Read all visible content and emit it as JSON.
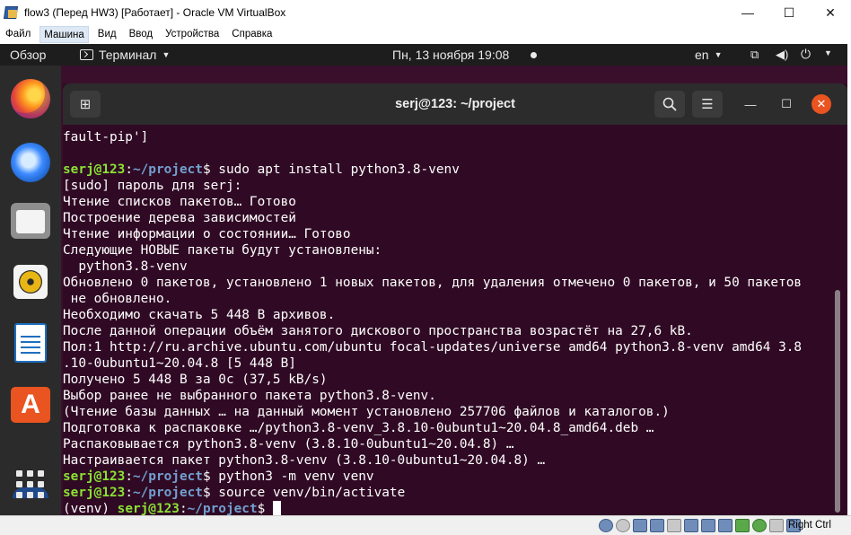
{
  "host_window": {
    "title": "flow3 (Перед HW3) [Работает] - Oracle VM VirtualBox",
    "controls": {
      "minimize": "—",
      "maximize": "☐",
      "close": "✕"
    }
  },
  "host_menu": [
    {
      "label": "Файл"
    },
    {
      "label": "Машина",
      "active": true
    },
    {
      "label": "Вид"
    },
    {
      "label": "Ввод"
    },
    {
      "label": "Устройства"
    },
    {
      "label": "Справка"
    }
  ],
  "topbar": {
    "overview": "Обзор",
    "app_name": "Терминал",
    "clock": "Пн, 13 ноября  19:08",
    "keyboard_layout": "en"
  },
  "dock": {
    "items": [
      "firefox-icon",
      "thunderbird-icon",
      "files-icon",
      "rhythmbox-icon",
      "libreoffice-writer-icon",
      "ubuntu-software-icon",
      "show-applications-icon"
    ]
  },
  "terminal": {
    "title": "serj@123: ~/project",
    "lines": [
      {
        "text": "fault-pip']"
      },
      {
        "text": ""
      },
      {
        "prompt_user": "serj@123",
        "prompt_path": "~/project",
        "command": "sudo apt install python3.8-venv"
      },
      {
        "text": "[sudo] пароль для serj:"
      },
      {
        "text": "Чтение списков пакетов… Готово"
      },
      {
        "text": "Построение дерева зависимостей"
      },
      {
        "text": "Чтение информации о состоянии… Готово"
      },
      {
        "text": "Следующие НОВЫЕ пакеты будут установлены:"
      },
      {
        "text": "  python3.8-venv"
      },
      {
        "text": "Обновлено 0 пакетов, установлено 1 новых пакетов, для удаления отмечено 0 пакетов, и 50 пакетов"
      },
      {
        "text": " не обновлено."
      },
      {
        "text": "Необходимо скачать 5 448 B архивов."
      },
      {
        "text": "После данной операции объём занятого дискового пространства возрастёт на 27,6 kB."
      },
      {
        "text": "Пол:1 http://ru.archive.ubuntu.com/ubuntu focal-updates/universe amd64 python3.8-venv amd64 3.8"
      },
      {
        "text": ".10-0ubuntu1~20.04.8 [5 448 B]"
      },
      {
        "text": "Получено 5 448 B за 0c (37,5 kB/s)"
      },
      {
        "text": "Выбор ранее не выбранного пакета python3.8-venv."
      },
      {
        "text": "(Чтение базы данных … на данный момент установлено 257706 файлов и каталогов.)"
      },
      {
        "text": "Подготовка к распаковке …/python3.8-venv_3.8.10-0ubuntu1~20.04.8_amd64.deb …"
      },
      {
        "text": "Распаковывается python3.8-venv (3.8.10-0ubuntu1~20.04.8) …"
      },
      {
        "text": "Настраивается пакет python3.8-venv (3.8.10-0ubuntu1~20.04.8) …"
      },
      {
        "prompt_user": "serj@123",
        "prompt_path": "~/project",
        "command": "python3 -m venv venv"
      },
      {
        "prompt_user": "serj@123",
        "prompt_path": "~/project",
        "command": "source venv/bin/activate"
      },
      {
        "prefix": "(venv) ",
        "prompt_user": "serj@123",
        "prompt_path": "~/project",
        "command": "",
        "cursor": true
      }
    ]
  },
  "statusbar": {
    "host_key": "Right Ctrl"
  }
}
